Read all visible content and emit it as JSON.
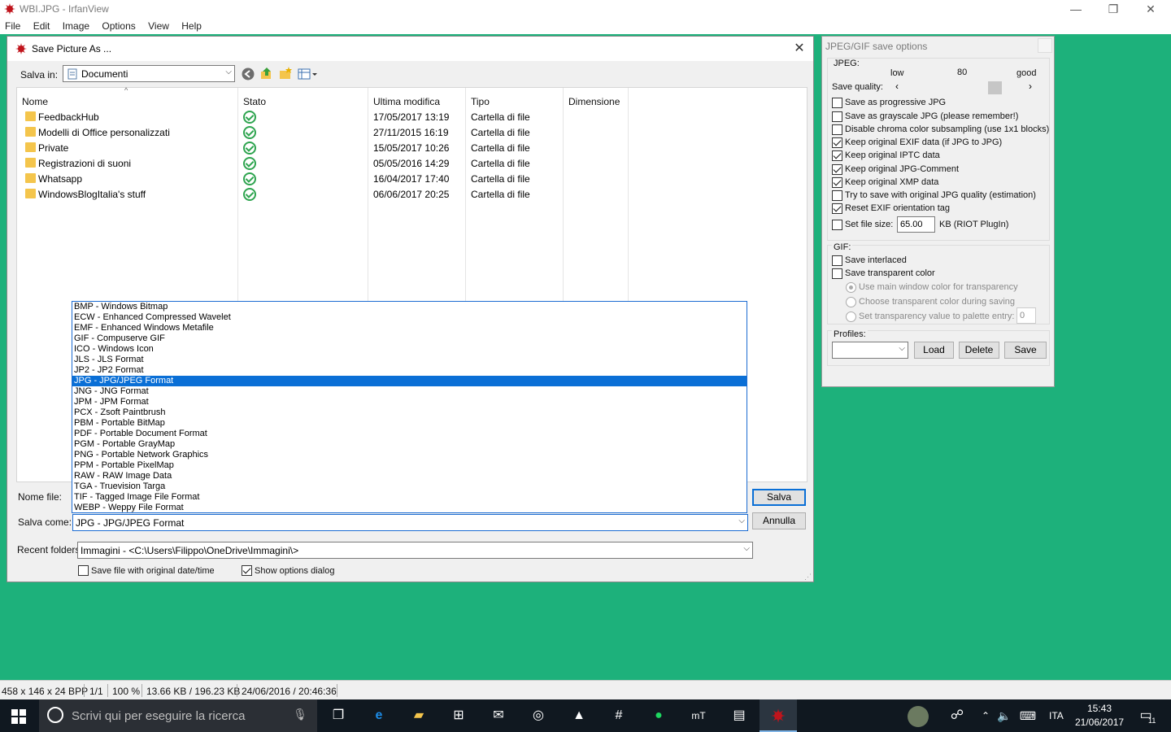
{
  "main_window": {
    "title": "WBI.JPG - IrfanView",
    "menu": [
      "File",
      "Edit",
      "Image",
      "Options",
      "View",
      "Help"
    ],
    "controls": {
      "minimize": "—",
      "restore": "❐",
      "close": "✕"
    },
    "canvas_color": "#1db17b"
  },
  "status_bar": {
    "dimensions": "458 x 146 x 24 BPP",
    "page": "1/1",
    "zoom": "100 %",
    "size": "13.66 KB / 196.23 KB",
    "datetime": "24/06/2016 / 20:46:36"
  },
  "save_dialog": {
    "title": "Save Picture As ...",
    "save_in_label": "Salva in:",
    "save_in_value": "Documenti",
    "columns": [
      "Nome",
      "Stato",
      "Ultima modifica",
      "Tipo",
      "Dimensione"
    ],
    "rows": [
      {
        "name": "FeedbackHub",
        "modified": "17/05/2017 13:19",
        "type": "Cartella di file"
      },
      {
        "name": "Modelli di Office personalizzati",
        "modified": "27/11/2015 16:19",
        "type": "Cartella di file"
      },
      {
        "name": "Private",
        "modified": "15/05/2017 10:26",
        "type": "Cartella di file"
      },
      {
        "name": "Registrazioni di suoni",
        "modified": "05/05/2016 14:29",
        "type": "Cartella di file"
      },
      {
        "name": "Whatsapp",
        "modified": "16/04/2017 17:40",
        "type": "Cartella di file"
      },
      {
        "name": "WindowsBlogItalia's stuff",
        "modified": "06/06/2017 20:25",
        "type": "Cartella di file"
      }
    ],
    "file_name_label": "Nome file:",
    "save_as_label": "Salva come:",
    "save_as_value": "JPG - JPG/JPEG Format",
    "save_button": "Salva",
    "cancel_button": "Annulla",
    "recent_label": "Recent folders:",
    "recent_value": "Immagini  -  <C:\\Users\\Filippo\\OneDrive\\Immagini\\>",
    "keep_date_label": "Save file with original date/time",
    "show_options_label": "Show options dialog",
    "formats": [
      "BMP - Windows Bitmap",
      "ECW - Enhanced Compressed Wavelet",
      "EMF - Enhanced Windows Metafile",
      "GIF - Compuserve GIF",
      "ICO - Windows Icon",
      "JLS - JLS Format",
      "JP2 - JP2 Format",
      "JPG - JPG/JPEG Format",
      "JNG - JNG Format",
      "JPM - JPM Format",
      "PCX - Zsoft Paintbrush",
      "PBM - Portable BitMap",
      "PDF - Portable Document Format",
      "PGM - Portable GrayMap",
      "PNG - Portable Network Graphics",
      "PPM - Portable PixelMap",
      "RAW - RAW Image Data",
      "TGA - Truevision Targa",
      "TIF - Tagged Image File Format",
      "WEBP - Weppy File Format"
    ],
    "selected_format_index": 7
  },
  "jpeg_options": {
    "title": "JPEG/GIF save options",
    "jpeg_group": "JPEG:",
    "quality_low": "low",
    "quality_value": "80",
    "quality_good": "good",
    "save_quality_label": "Save quality:",
    "options": [
      {
        "label": "Save as progressive JPG",
        "checked": false
      },
      {
        "label": "Save as grayscale JPG (please remember!)",
        "checked": false
      },
      {
        "label": "Disable chroma color subsampling (use 1x1 blocks)",
        "checked": false
      },
      {
        "label": "Keep original EXIF data (if JPG to JPG)",
        "checked": true
      },
      {
        "label": "Keep original IPTC data",
        "checked": true
      },
      {
        "label": "Keep original JPG-Comment",
        "checked": true
      },
      {
        "label": "Keep original XMP data",
        "checked": true
      },
      {
        "label": "Try to save with original JPG quality (estimation)",
        "checked": false
      },
      {
        "label": "Reset EXIF orientation tag",
        "checked": true
      }
    ],
    "set_file_size_label": "Set file size:",
    "set_file_size_value": "65.00",
    "set_file_size_unit": "KB (RIOT PlugIn)",
    "gif_group": "GIF:",
    "save_interlaced": "Save interlaced",
    "save_transparent": "Save transparent color",
    "radio_main": "Use main window color for transparency",
    "radio_choose": "Choose transparent color during saving",
    "radio_palette": "Set transparency value to palette entry:",
    "palette_value": "0",
    "profiles_label": "Profiles:",
    "load_button": "Load",
    "delete_button": "Delete",
    "save_button": "Save"
  },
  "taskbar": {
    "search_placeholder": "Scrivi qui per eseguire la ricerca",
    "language": "ITA",
    "time": "15:43",
    "date": "21/06/2017",
    "notifications": "11"
  }
}
